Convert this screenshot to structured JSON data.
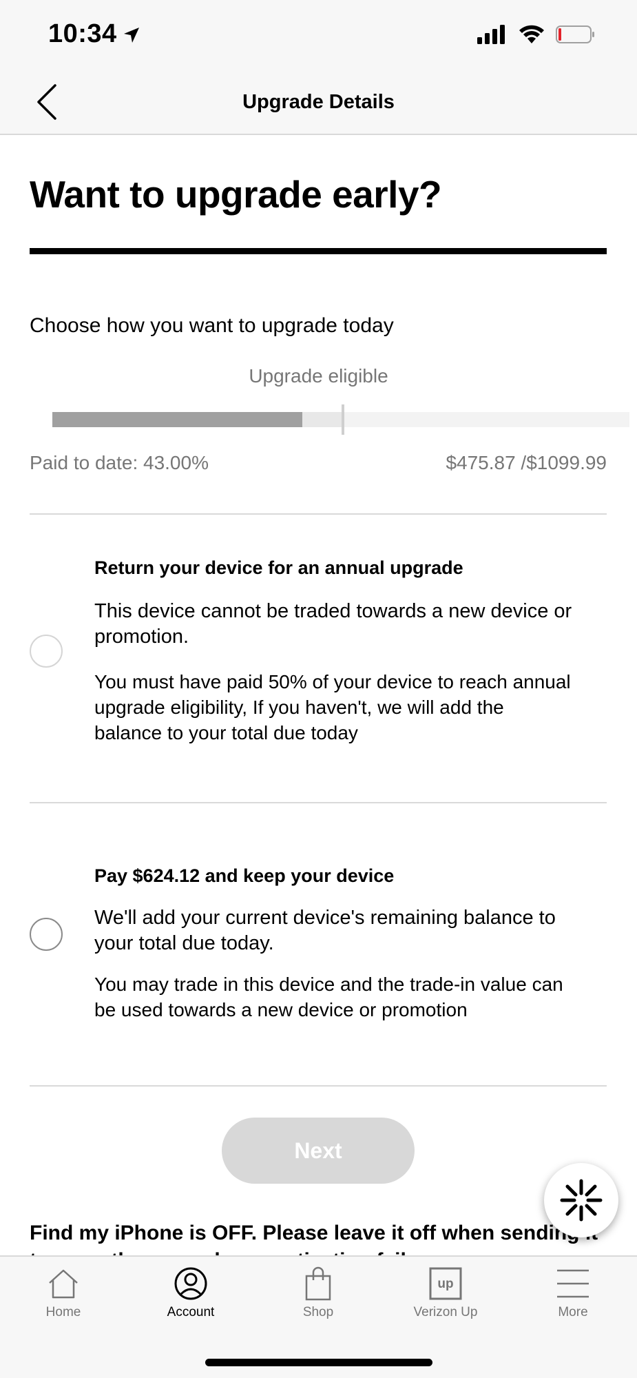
{
  "status": {
    "time": "10:34",
    "icons": [
      "location-arrow-icon",
      "signal-icon",
      "wifi-icon",
      "battery-low-icon"
    ]
  },
  "header": {
    "title": "Upgrade Details",
    "back_icon": "chevron-left-icon"
  },
  "main": {
    "headline": "Want to upgrade early?",
    "choose_text": "Choose how you want to upgrade today",
    "eligible_label": "Upgrade eligible",
    "progress": {
      "paid_fraction": 0.43,
      "eligible_marker_fraction": 0.5,
      "paid_label": "Paid to date: 43.00%",
      "amount_label": "$475.87 /$1099.99"
    },
    "options": [
      {
        "title": "Return your device for an annual upgrade",
        "text1": "This device cannot be traded towards a new device or promotion.",
        "text2": "You must have paid 50% of your device to reach annual upgrade eligibility, If you haven't, we will add the balance to your total due today",
        "selected": false
      },
      {
        "title": "Pay $624.12 and keep your device",
        "text1": "We'll add your current device's remaining balance to your total due today.",
        "text2": "You may trade in this device and the trade-in value can be used towards a new device or promotion",
        "selected": false
      }
    ],
    "next_label": "Next",
    "find_iphone_text": "Find my iPhone is OFF. Please leave it off when sending it to us or there may be an activation failure."
  },
  "chat": {
    "icon": "chat-burst-icon"
  },
  "tabbar": {
    "items": [
      {
        "label": "Home",
        "icon": "home-icon"
      },
      {
        "label": "Account",
        "icon": "account-icon",
        "active": true
      },
      {
        "label": "Shop",
        "icon": "shopping-bag-icon"
      },
      {
        "label": "Verizon Up",
        "icon": "verizon-up-icon",
        "badge": "up"
      },
      {
        "label": "More",
        "icon": "menu-icon"
      }
    ]
  },
  "colors": {
    "accent": "#000000",
    "progress_fill": "#a0a0a0",
    "muted_text": "#767676",
    "battery_low": "#e3242b"
  }
}
